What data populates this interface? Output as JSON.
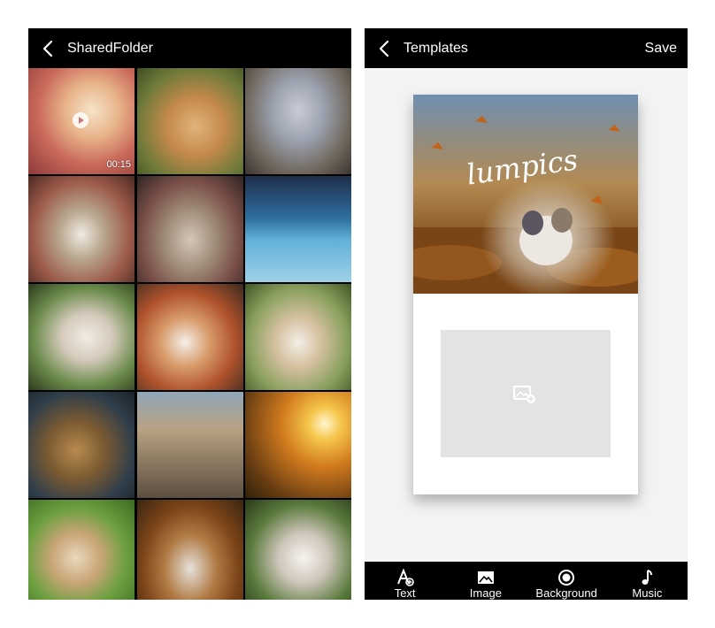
{
  "left_screen": {
    "title": "SharedFolder",
    "video_duration": "00:15",
    "thumbnails": [
      {
        "name": "video-thumbnail-abstract",
        "kind": "video"
      },
      {
        "name": "photo-golden-retriever"
      },
      {
        "name": "photo-dog-in-costume"
      },
      {
        "name": "photo-dogs-group"
      },
      {
        "name": "photo-kittens-basket"
      },
      {
        "name": "photo-blue-forest-deer"
      },
      {
        "name": "photo-white-rabbit"
      },
      {
        "name": "photo-red-panda"
      },
      {
        "name": "photo-guinea-pig"
      },
      {
        "name": "photo-monkeys"
      },
      {
        "name": "photo-cats-on-rocks"
      },
      {
        "name": "photo-autumn-sunset"
      },
      {
        "name": "photo-guinea-pig-grass"
      },
      {
        "name": "photo-dog-autumn-leaves"
      },
      {
        "name": "photo-white-bunny"
      }
    ]
  },
  "right_screen": {
    "title": "Templates",
    "save_label": "Save",
    "watermark_text": "lumpics",
    "toolbar": {
      "text_label": "Text",
      "image_label": "Image",
      "background_label": "Background",
      "music_label": "Music"
    }
  },
  "colors": {
    "bar_background": "#000000",
    "bar_text": "#ffffff",
    "editor_background": "#f3f3f3",
    "placeholder": "#e3e3e3"
  }
}
